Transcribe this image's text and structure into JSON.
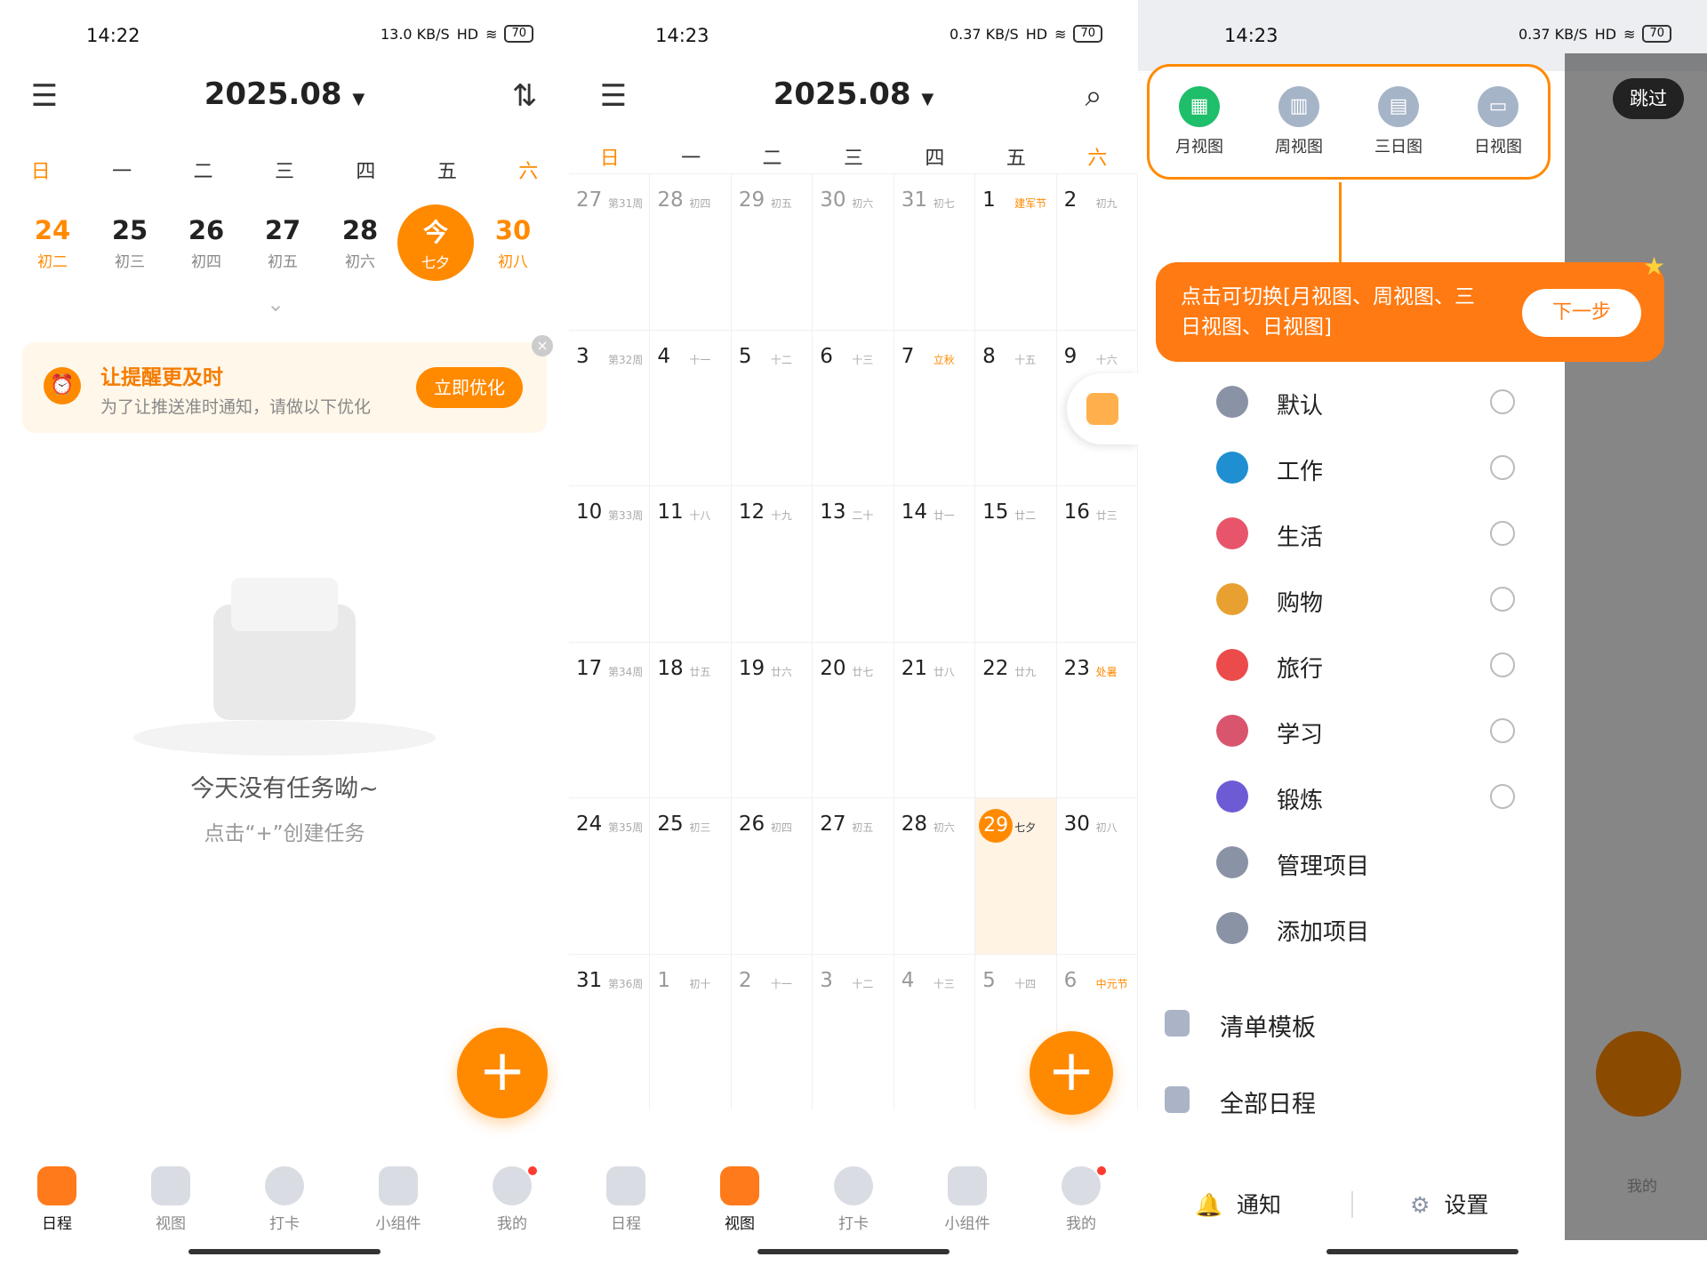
{
  "colors": {
    "accent": "#ff8a00",
    "today_bg": "#fff3e4",
    "green": "#1ebe6a"
  },
  "screen1": {
    "status": {
      "time": "14:22",
      "net": "13.0 KB/S",
      "hd": "HD",
      "battery": "70"
    },
    "header": {
      "title": "2025.08",
      "menu_icon": "list-icon",
      "sort_icon": "sort-icon"
    },
    "weekdays": [
      "日",
      "一",
      "二",
      "三",
      "四",
      "五",
      "六"
    ],
    "days": [
      {
        "d": "24",
        "l": "初二"
      },
      {
        "d": "25",
        "l": "初三"
      },
      {
        "d": "26",
        "l": "初四"
      },
      {
        "d": "27",
        "l": "初五"
      },
      {
        "d": "28",
        "l": "初六"
      },
      {
        "d": "今",
        "l": "七夕"
      },
      {
        "d": "30",
        "l": "初八"
      }
    ],
    "banner": {
      "title": "让提醒更及时",
      "subtitle": "为了让推送准时通知，请做以下优化",
      "button": "立即优化"
    },
    "empty": {
      "title": "今天没有任务呦~",
      "hint": "点击“+”创建任务"
    },
    "fab": "+",
    "tabs": [
      "日程",
      "视图",
      "打卡",
      "小组件",
      "我的"
    ]
  },
  "screen2": {
    "status": {
      "time": "14:23",
      "net": "0.37 KB/S",
      "hd": "HD",
      "battery": "70"
    },
    "header": {
      "title": "2025.08"
    },
    "weekdays": [
      "日",
      "一",
      "二",
      "三",
      "四",
      "五",
      "六"
    ],
    "weeks": [
      [
        {
          "d": "27",
          "l": "第31周",
          "dim": true
        },
        {
          "d": "28",
          "l": "初四",
          "dim": true
        },
        {
          "d": "29",
          "l": "初五",
          "dim": true
        },
        {
          "d": "30",
          "l": "初六",
          "dim": true
        },
        {
          "d": "31",
          "l": "初七",
          "dim": true
        },
        {
          "d": "1",
          "l": "建军节",
          "fest": true
        },
        {
          "d": "2",
          "l": "初九"
        }
      ],
      [
        {
          "d": "3",
          "l": "第32周"
        },
        {
          "d": "4",
          "l": "十一"
        },
        {
          "d": "5",
          "l": "十二"
        },
        {
          "d": "6",
          "l": "十三"
        },
        {
          "d": "7",
          "l": "立秋",
          "fest": true
        },
        {
          "d": "8",
          "l": "十五"
        },
        {
          "d": "9",
          "l": "十六"
        }
      ],
      [
        {
          "d": "10",
          "l": "第33周"
        },
        {
          "d": "11",
          "l": "十八"
        },
        {
          "d": "12",
          "l": "十九"
        },
        {
          "d": "13",
          "l": "二十"
        },
        {
          "d": "14",
          "l": "廿一"
        },
        {
          "d": "15",
          "l": "廿二"
        },
        {
          "d": "16",
          "l": "廿三"
        }
      ],
      [
        {
          "d": "17",
          "l": "第34周"
        },
        {
          "d": "18",
          "l": "廿五"
        },
        {
          "d": "19",
          "l": "廿六"
        },
        {
          "d": "20",
          "l": "廿七"
        },
        {
          "d": "21",
          "l": "廿八"
        },
        {
          "d": "22",
          "l": "廿九"
        },
        {
          "d": "23",
          "l": "处暑",
          "fest": true
        }
      ],
      [
        {
          "d": "24",
          "l": "第35周"
        },
        {
          "d": "25",
          "l": "初三"
        },
        {
          "d": "26",
          "l": "初四"
        },
        {
          "d": "27",
          "l": "初五"
        },
        {
          "d": "28",
          "l": "初六"
        },
        {
          "d": "29",
          "l": "七夕",
          "today": true
        },
        {
          "d": "30",
          "l": "初八"
        }
      ],
      [
        {
          "d": "31",
          "l": "第36周"
        },
        {
          "d": "1",
          "l": "初十",
          "dim": true
        },
        {
          "d": "2",
          "l": "十一",
          "dim": true
        },
        {
          "d": "3",
          "l": "十二",
          "dim": true
        },
        {
          "d": "4",
          "l": "十三",
          "dim": true
        },
        {
          "d": "5",
          "l": "十四",
          "dim": true
        },
        {
          "d": "6",
          "l": "中元节",
          "dim": true,
          "fest": true
        }
      ]
    ],
    "fab": "+",
    "tabs": [
      "日程",
      "视图",
      "打卡",
      "小组件",
      "我的"
    ]
  },
  "screen3": {
    "status": {
      "time": "14:23",
      "net": "0.37 KB/S",
      "hd": "HD",
      "battery": "70"
    },
    "skip": "跳过",
    "views": [
      "月视图",
      "周视图",
      "三日图",
      "日视图"
    ],
    "tip": {
      "text": "点击可切换[月视图、周视图、三日视图、日视图]",
      "next": "下一步"
    },
    "projects": [
      {
        "label": "默认",
        "color": "#8a93a6"
      },
      {
        "label": "工作",
        "color": "#1f8fd1"
      },
      {
        "label": "生活",
        "color": "#e8556b"
      },
      {
        "label": "购物",
        "color": "#e8a030"
      },
      {
        "label": "旅行",
        "color": "#ec4b4b"
      },
      {
        "label": "学习",
        "color": "#d9556d"
      },
      {
        "label": "锻炼",
        "color": "#6d5bd6"
      },
      {
        "label": "管理项目",
        "color": "#8a93a6"
      },
      {
        "label": "添加项目",
        "color": "#8a93a6"
      }
    ],
    "menu": [
      "清单模板",
      "全部日程"
    ],
    "bottom": {
      "notify": "通知",
      "settings": "设置"
    },
    "bg_tab_label": "我的"
  }
}
